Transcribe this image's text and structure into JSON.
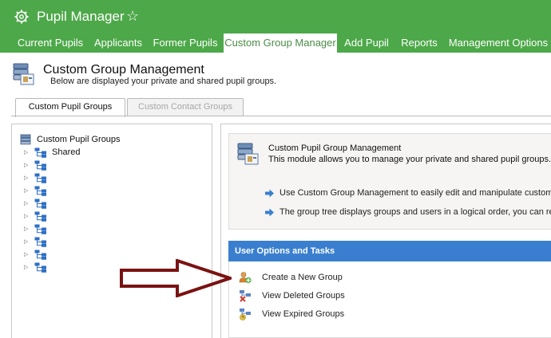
{
  "app": {
    "title": "Pupil Manager",
    "icon": "gear-icon",
    "favorite_icon": "star-outline-icon"
  },
  "nav": {
    "tabs": [
      {
        "label": "Current Pupils",
        "active": false
      },
      {
        "label": "Applicants",
        "active": false
      },
      {
        "label": "Former Pupils",
        "active": false
      },
      {
        "label": "Custom Group Manager",
        "active": true
      },
      {
        "label": "Add Pupil",
        "active": false
      },
      {
        "label": "Reports",
        "active": false
      },
      {
        "label": "Management Options",
        "active": false
      }
    ]
  },
  "page": {
    "title": "Custom Group Management",
    "subtitle": "Below are displayed your private and shared pupil groups."
  },
  "subtabs": [
    {
      "label": "Custom Pupil Groups",
      "active": true
    },
    {
      "label": "Custom Contact Groups",
      "active": false
    }
  ],
  "tree": {
    "root_label": "Custom Pupil Groups",
    "nodes": [
      {
        "label": "Shared"
      },
      {
        "label": ""
      },
      {
        "label": ""
      },
      {
        "label": ""
      },
      {
        "label": ""
      },
      {
        "label": ""
      },
      {
        "label": ""
      },
      {
        "label": ""
      },
      {
        "label": ""
      },
      {
        "label": ""
      }
    ]
  },
  "info": {
    "title": "Custom Pupil Group Management",
    "description": "This module allows you to manage your private and shared pupil groups.",
    "bullets": [
      "Use Custom Group Management to easily edit and manipulate custom",
      "The group tree displays groups and users in a logical order, you can re"
    ]
  },
  "options": {
    "header": "User Options and Tasks",
    "tasks": [
      {
        "label": "Create a New Group",
        "icon": "add-group-icon"
      },
      {
        "label": "View Deleted Groups",
        "icon": "deleted-groups-icon"
      },
      {
        "label": "View Expired Groups",
        "icon": "expired-groups-icon"
      }
    ]
  },
  "colors": {
    "brand_green": "#4da849",
    "options_blue": "#3a7fcf",
    "arrow_red": "#7a1212",
    "active_tab_text": "#4a8d46"
  }
}
